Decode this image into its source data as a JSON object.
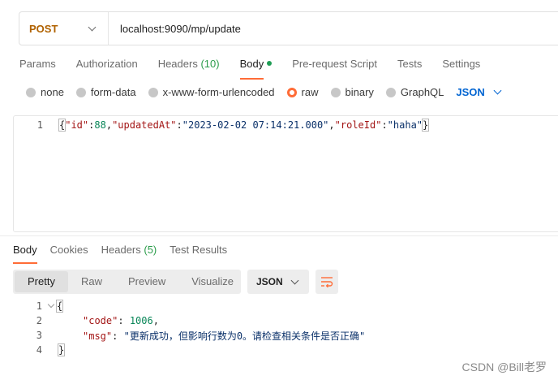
{
  "request": {
    "method": "POST",
    "url": "localhost:9090/mp/update"
  },
  "request_tabs": [
    {
      "label": "Params"
    },
    {
      "label": "Authorization"
    },
    {
      "label": "Headers",
      "count": "(10)"
    },
    {
      "label": "Body"
    },
    {
      "label": "Pre-request Script"
    },
    {
      "label": "Tests"
    },
    {
      "label": "Settings"
    }
  ],
  "body_types": [
    {
      "label": "none",
      "selected": false
    },
    {
      "label": "form-data",
      "selected": false
    },
    {
      "label": "x-www-form-urlencoded",
      "selected": false
    },
    {
      "label": "raw",
      "selected": true
    },
    {
      "label": "binary",
      "selected": false
    },
    {
      "label": "GraphQL",
      "selected": false
    }
  ],
  "body_format": "JSON",
  "request_body": {
    "line_no": "1",
    "open": "{",
    "q1": "\"id\"",
    "c1": ":",
    "v1": "88",
    "s1": ",",
    "q2": "\"updatedAt\"",
    "c2": ":",
    "v2": "\"2023-02-02 07:14:21.000\"",
    "s2": ",",
    "q3": "\"roleId\"",
    "c3": ":",
    "v3": "\"haha\"",
    "close": "}"
  },
  "response_tabs": [
    {
      "label": "Body"
    },
    {
      "label": "Cookies"
    },
    {
      "label": "Headers",
      "count": "(5)"
    },
    {
      "label": "Test Results"
    }
  ],
  "view_modes": [
    "Pretty",
    "Raw",
    "Preview",
    "Visualize"
  ],
  "response_format": "JSON",
  "response_body": {
    "lines": [
      "1",
      "2",
      "3",
      "4"
    ],
    "open": "{",
    "key1": "\"code\"",
    "val1": "1006",
    "key2": "\"msg\"",
    "val2": "\"更新成功，但影响行数为0。请检查相关条件是否正确\"",
    "colon": ":",
    "comma": ",",
    "close": "}"
  },
  "watermark": "CSDN @Bill老罗"
}
